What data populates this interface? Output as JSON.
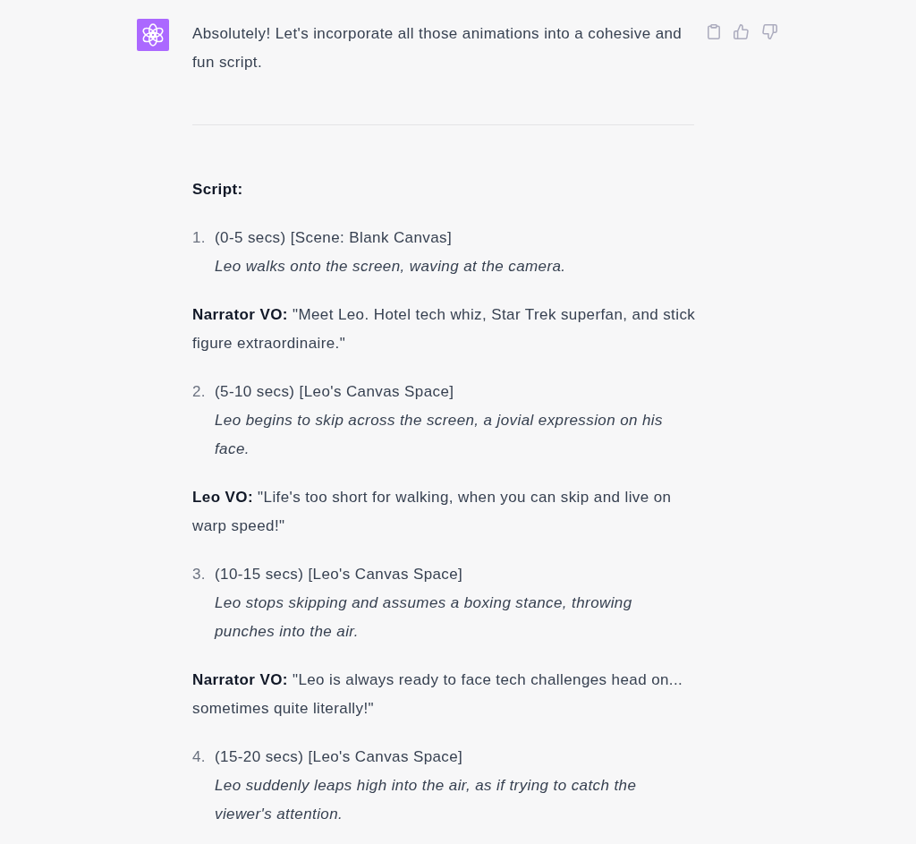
{
  "message": {
    "text": "Absolutely! Let's incorporate all those animations into a cohesive and fun script."
  },
  "script": {
    "heading": "Script:",
    "blocks": [
      {
        "kind": "step",
        "number": "1.",
        "timing": "(0-5 secs) [Scene: Blank Canvas]",
        "action": "Leo walks onto the screen, waving at the camera."
      },
      {
        "kind": "voiceover",
        "text": "**Narrator VO:** \"Meet Leo. Hotel tech whiz, Star Trek superfan, and stick figure extraordinaire.\""
      },
      {
        "kind": "step",
        "number": "2.",
        "timing": "(5-10 secs) [Leo's Canvas Space]",
        "action": "Leo begins to skip across the screen, a jovial expression on his face."
      },
      {
        "kind": "voiceover",
        "text": "**Leo VO:** \"Life's too short for walking, when you can skip and live on warp speed!\""
      },
      {
        "kind": "step",
        "number": "3.",
        "timing": "(10-15 secs) [Leo's Canvas Space]",
        "action": "Leo stops skipping and assumes a boxing stance, throwing punches into the air."
      },
      {
        "kind": "voiceover",
        "text": "**Narrator VO:** \"Leo is always ready to face tech challenges head on... sometimes quite literally!\""
      },
      {
        "kind": "step",
        "number": "4.",
        "timing": "(15-20 secs) [Leo's Canvas Space]",
        "action": "Leo suddenly leaps high into the air, as if trying to catch the viewer's attention."
      }
    ]
  }
}
